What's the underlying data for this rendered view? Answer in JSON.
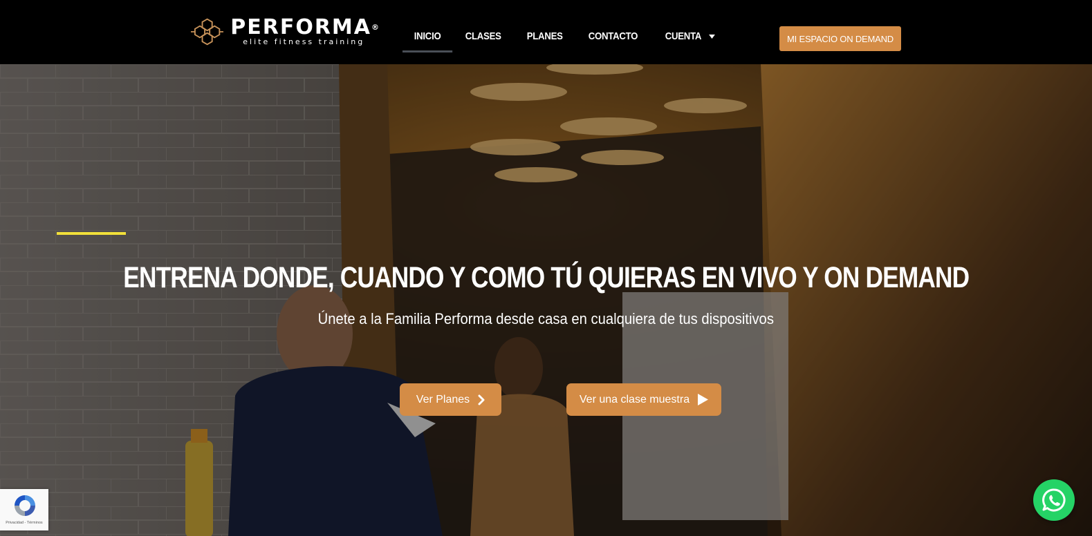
{
  "brand": {
    "name": "PERFORMA",
    "registered_mark": "®",
    "tagline": "elite fitness training",
    "logo_icon": "hexagon-cluster-logo-icon",
    "accent_color": "#d48c46"
  },
  "nav": {
    "items": [
      {
        "label": "INICIO",
        "active": true
      },
      {
        "label": "CLASES",
        "active": false
      },
      {
        "label": "PLANES",
        "active": false
      },
      {
        "label": "CONTACTO",
        "active": false
      },
      {
        "label": "CUENTA",
        "active": false,
        "icon": "caret-down-icon"
      }
    ],
    "cta_label": "MI ESPACIO ON DEMAND"
  },
  "hero": {
    "title": "ENTRENA DONDE, CUANDO Y COMO TÚ QUIERAS EN VIVO Y ON DEMAND",
    "subtitle": "Únete a la Familia Performa desde casa en cualquiera de tus dispositivos",
    "accent_line_color": "#f2e03a",
    "buttons": [
      {
        "label": "Ver Planes",
        "icon": "chevron-right-icon"
      },
      {
        "label": "Ver una clase muestra",
        "icon": "play-icon"
      }
    ]
  },
  "recaptcha": {
    "text": "Privacidad - Términos",
    "icon": "recaptcha-icon"
  },
  "whatsapp": {
    "icon": "whatsapp-icon",
    "color": "#25d366"
  }
}
